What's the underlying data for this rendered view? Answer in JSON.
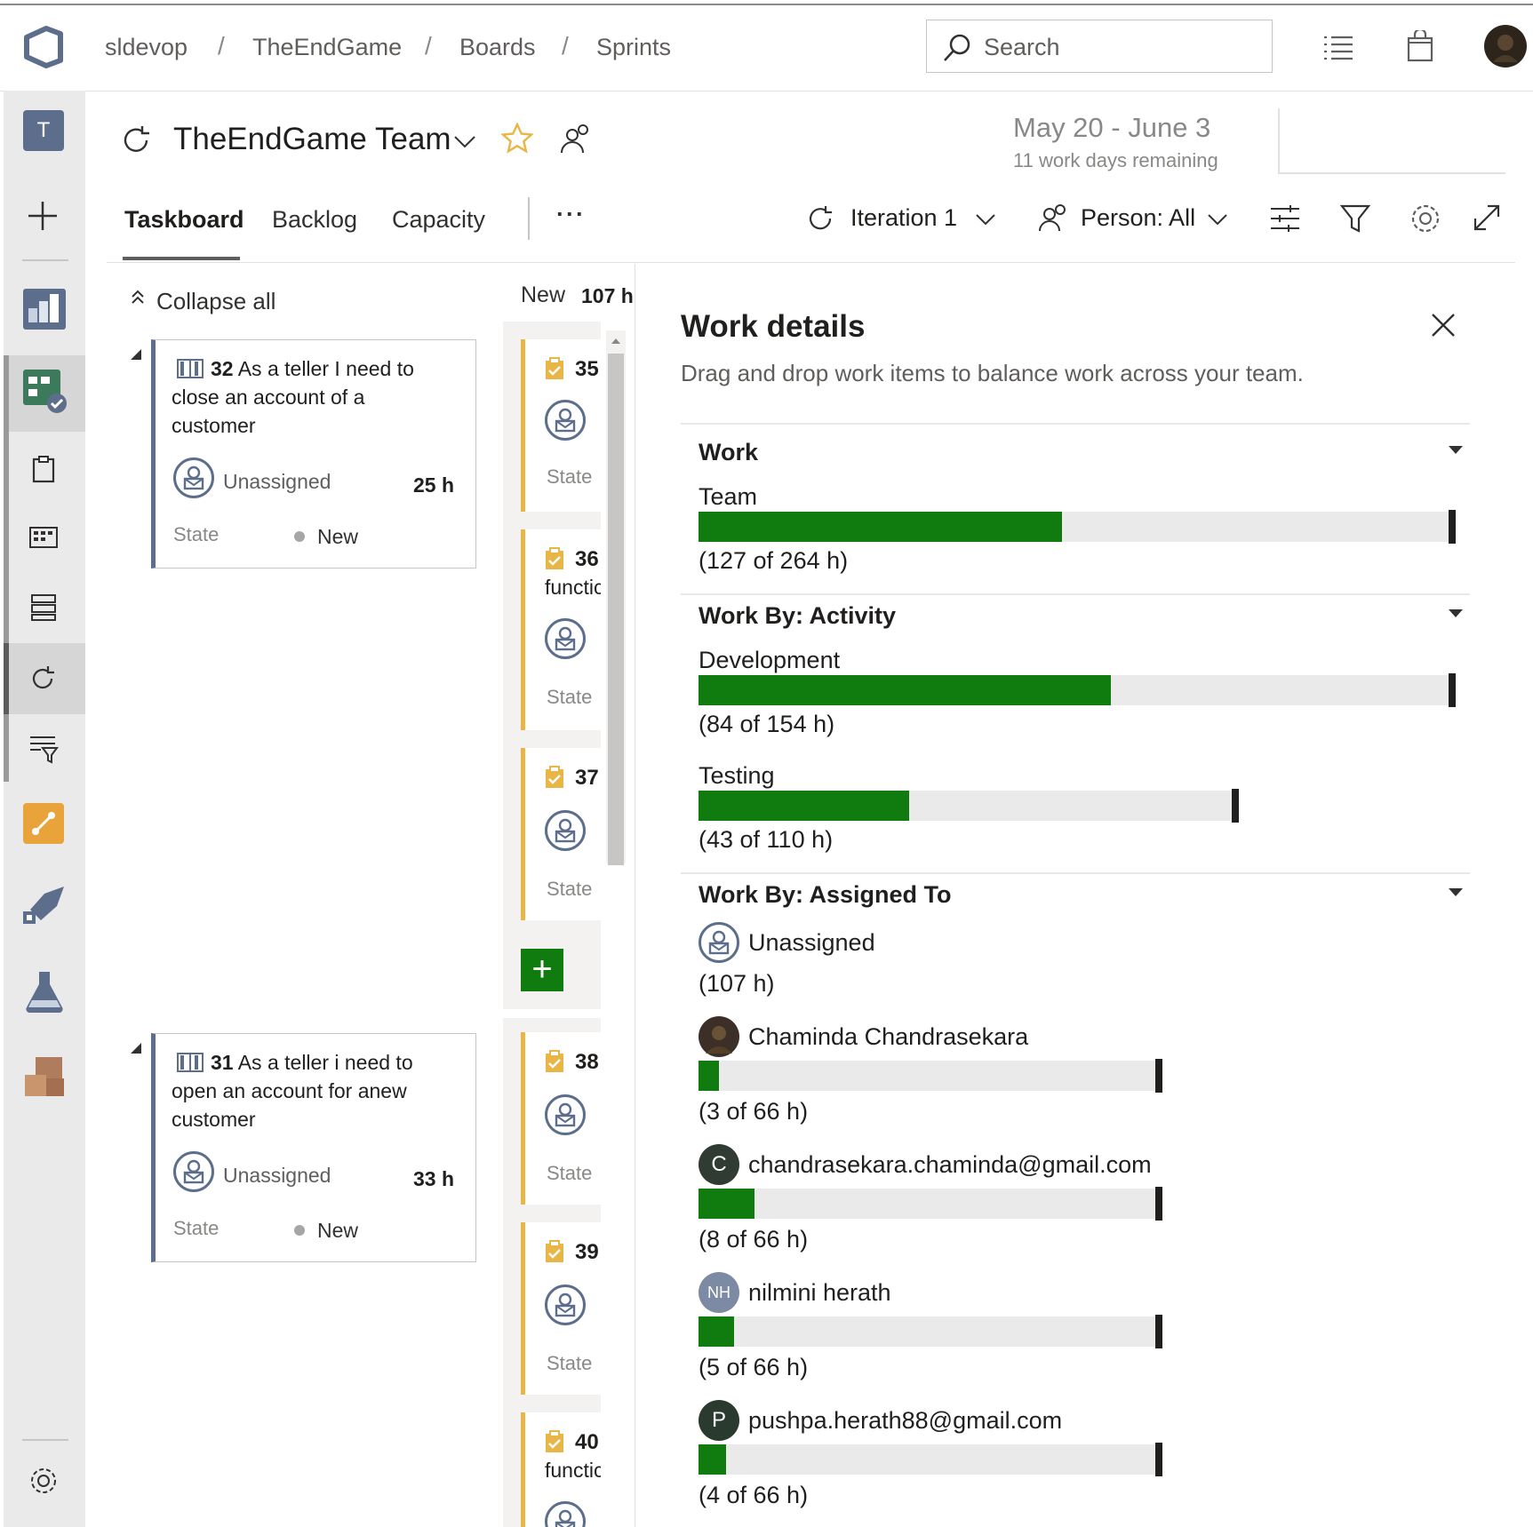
{
  "breadcrumb": {
    "org": "sldevop",
    "project": "TheEndGame",
    "hub": "Boards",
    "page": "Sprints",
    "sep": "/"
  },
  "search": {
    "placeholder": "Search"
  },
  "nav": {
    "avatar_letter": "T",
    "items": [
      "plus-icon",
      "overview-icon",
      "boards-icon",
      "work-items-icon",
      "board-icon",
      "backlog-icon",
      "sprints-icon",
      "queries-icon",
      "repos-icon",
      "pipelines-icon",
      "test-plans-icon",
      "artifacts-icon",
      "settings-icon"
    ]
  },
  "header": {
    "team": "TheEndGame Team",
    "date_range": "May 20 - June 3",
    "days_remaining": "11 work days remaining"
  },
  "tabs": {
    "taskboard": "Taskboard",
    "backlog": "Backlog",
    "capacity": "Capacity",
    "more": "···"
  },
  "toolbar": {
    "iteration": "Iteration 1",
    "person": "Person: All"
  },
  "board": {
    "collapse_all": "Collapse all",
    "new_column": "New",
    "new_column_hours": "107 h",
    "stories": [
      {
        "id": "32",
        "title_l1": "As a teller I need to",
        "title_l2": "close an account of a",
        "title_l3": "customer",
        "assignee": "Unassigned",
        "hours": "25 h",
        "state_label": "State",
        "state": "New"
      },
      {
        "id": "31",
        "title_l1": "As a teller i need to",
        "title_l2": "open an account for anew",
        "title_l3": "customer",
        "assignee": "Unassigned",
        "hours": "33 h",
        "state_label": "State",
        "state": "New"
      }
    ],
    "tasks": [
      {
        "id": "35",
        "line2": "",
        "state_label": "State"
      },
      {
        "id": "36",
        "line2": "functic",
        "state_label": "State"
      },
      {
        "id": "37",
        "line2": "",
        "state_label": "State"
      },
      {
        "id": "38",
        "line2": "",
        "state_label": "State"
      },
      {
        "id": "39",
        "line2": "",
        "state_label": "State"
      },
      {
        "id": "40",
        "line2": "functic",
        "state_label": "State"
      }
    ],
    "add_button": "+"
  },
  "panel": {
    "title": "Work details",
    "subtitle": "Drag and drop work items to balance work across your team.",
    "work": {
      "title": "Work",
      "team_label": "Team",
      "team_value": "(127 of 264 h)",
      "team_fraction": 0.48
    },
    "activity": {
      "title": "Work By: Activity",
      "items": [
        {
          "label": "Development",
          "value": "(84 of 154 h)",
          "fraction": 0.545
        },
        {
          "label": "Testing",
          "value": "(43 of 110 h)",
          "fraction": 0.39
        }
      ]
    },
    "assigned": {
      "title": "Work By: Assigned To",
      "unassigned_label": "Unassigned",
      "unassigned_value": "(107 h)",
      "people": [
        {
          "name": "Chaminda Chandrasekara",
          "initials": "",
          "value": "(3 of 66 h)",
          "fraction": 0.045,
          "color": "#3b2f28"
        },
        {
          "name": "chandrasekara.chaminda@gmail.com",
          "initials": "C",
          "value": "(8 of 66 h)",
          "fraction": 0.12,
          "color": "#2f3b33"
        },
        {
          "name": "nilmini herath",
          "initials": "NH",
          "value": "(5 of 66 h)",
          "fraction": 0.076,
          "color": "#7d8aa3"
        },
        {
          "name": "pushpa.herath88@gmail.com",
          "initials": "P",
          "value": "(4 of 66 h)",
          "fraction": 0.06,
          "color": "#2b3a2f"
        }
      ]
    }
  },
  "colors": {
    "progress_fill": "#107c10",
    "progress_track": "#eaeaea",
    "story_border": "#5c6e8b",
    "task_border": "#e8b646",
    "favorite_star": "#e8b646"
  }
}
